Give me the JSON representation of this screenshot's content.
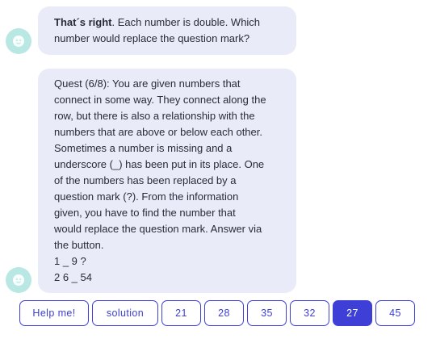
{
  "messages": [
    {
      "bold": "That´s right",
      "text": ". Each number is double. Which",
      "text2": "number would replace the question mark?"
    },
    {
      "lines": [
        "Quest (6/8): You are given numbers that",
        "connect in some way. They connect along the",
        "row, but there is also a relationship with the",
        "numbers that are above or below each other.",
        "Sometimes a number is missing and a",
        "underscore (_) has been put in its place. One",
        "of the numbers has been replaced by a",
        "question mark (?). From the information",
        "given, you have to find the number that",
        "would replace the question mark. Answer via",
        "the button.",
        "1 _ 9 ?",
        "2 6 _ 54"
      ]
    }
  ],
  "answers": [
    "Help me!",
    "solution",
    "21",
    "28",
    "35",
    "32",
    "27",
    "45"
  ],
  "selected_answer": "27",
  "colors": {
    "accent": "#3d3fd6",
    "bubble": "#eaebf8",
    "avatar": "#b9e8e4"
  },
  "icons": {
    "avatar": "bot-face-icon"
  }
}
